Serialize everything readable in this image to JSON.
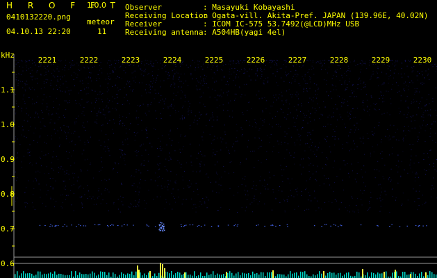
{
  "app": {
    "name": "H R O F F T",
    "version": "1.0.0"
  },
  "file": {
    "name": "0410132220.png",
    "datetime": "04.10.13 22:20"
  },
  "meteor": {
    "label": "meteor",
    "count": "11"
  },
  "info": [
    {
      "label": "Observer",
      "value": ": Masayuki Kobayashi"
    },
    {
      "label": "Receiving Location",
      "value": ": Ogata-vill. Akita-Pref. JAPAN (139.96E, 40.02N)"
    },
    {
      "label": "Receiver",
      "value": ": ICOM IC-575 53.7492(@LCD)MHz USB"
    },
    {
      "label": "Receiving antenna",
      "value": ": A504HB(yagi 4el)"
    }
  ],
  "spectrogram": {
    "y_unit": "kHz",
    "time_ticks": [
      "2221",
      "2222",
      "2223",
      "2224",
      "2225",
      "2226",
      "2227",
      "2228",
      "2229",
      "2230"
    ],
    "freq_ticks": [
      "1.1",
      "1.0",
      "0.9",
      "0.8",
      "0.7",
      "0.6"
    ],
    "colors": {
      "text": "#ffff00",
      "noise": "#1a1a78",
      "signal": "#4a6cff",
      "bar_low": "#00d8c8",
      "bar_high": "#ffff40",
      "ref_line": "#9a9a9a"
    }
  }
}
